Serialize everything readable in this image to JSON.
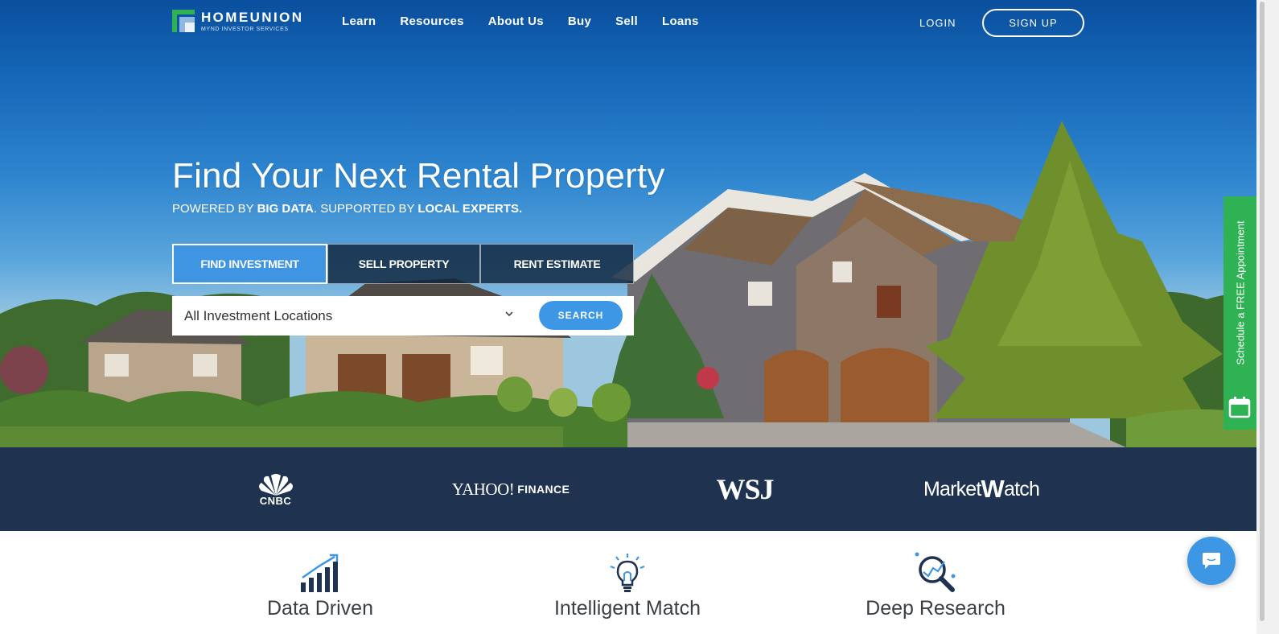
{
  "brand": {
    "name": "HOMEUNION",
    "subtitle": "MYND INVESTOR SERVICES"
  },
  "nav": {
    "links": [
      "Learn",
      "Resources",
      "About Us",
      "Buy",
      "Sell",
      "Loans"
    ],
    "login": "LOGIN",
    "signup": "SIGN UP"
  },
  "hero": {
    "headline": "Find Your Next Rental Property",
    "tagline": {
      "p1": "POWERED BY ",
      "b1": "BIG DATA",
      "p2": ". SUPPORTED BY ",
      "b2": "LOCAL EXPERTS."
    },
    "tabs": [
      "FIND INVESTMENT",
      "SELL PROPERTY",
      "RENT ESTIMATE"
    ],
    "active_tab": "FIND INVESTMENT"
  },
  "search": {
    "location_value": "All Investment Locations",
    "button": "SEARCH"
  },
  "side_tab": {
    "label": "Schedule a FREE Appointment",
    "icon": "calendar-icon"
  },
  "press": {
    "cnbc": "CNBC",
    "yahoo_main": "YAHOO!",
    "yahoo_finance": "FINANCE",
    "wsj": "WSJ",
    "marketwatch_a": "Market",
    "marketwatch_b": "W",
    "marketwatch_c": "atch"
  },
  "features": [
    {
      "title": "Data Driven",
      "icon": "growth-chart-icon"
    },
    {
      "title": "Intelligent Match",
      "icon": "lightbulb-icon"
    },
    {
      "title": "Deep Research",
      "icon": "magnifier-chart-icon"
    }
  ],
  "chat": {
    "icon": "chat-bubble-icon"
  },
  "colors": {
    "accent": "#3e97e4",
    "press_bar": "#1f3250",
    "side_tab": "#2fb254",
    "feature_text": "#3a3f46"
  }
}
